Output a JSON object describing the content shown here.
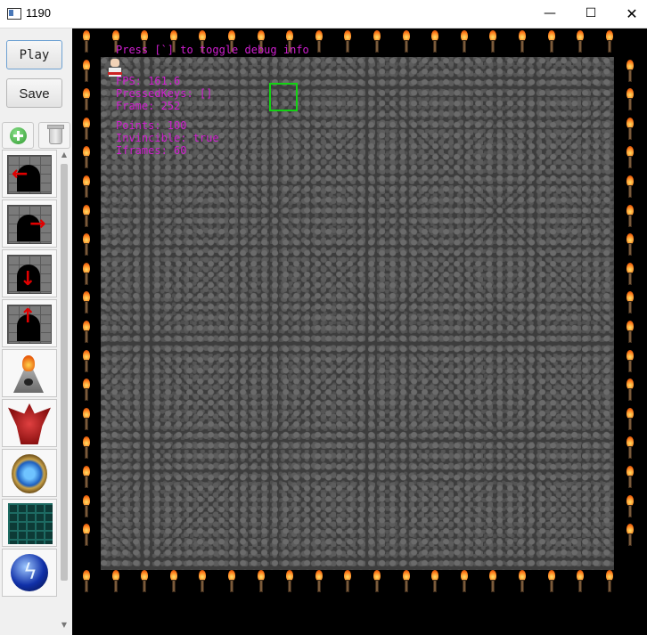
{
  "window": {
    "title": "1190",
    "minimize_glyph": "—",
    "maximize_glyph": "☐",
    "close_glyph": "✕"
  },
  "palette": {
    "play_label": "Play",
    "save_label": "Save",
    "tools": [
      {
        "name": "add-icon"
      },
      {
        "name": "trash-icon"
      }
    ],
    "items": [
      {
        "name": "door-left",
        "arrow": "←"
      },
      {
        "name": "door-right",
        "arrow": "→"
      },
      {
        "name": "door-down",
        "arrow": "↓"
      },
      {
        "name": "door-up",
        "arrow": "↑"
      },
      {
        "name": "fountain"
      },
      {
        "name": "dragon"
      },
      {
        "name": "portal"
      },
      {
        "name": "maze-tile"
      },
      {
        "name": "lightning-orb"
      }
    ],
    "scroll_up_glyph": "▲",
    "scroll_down_glyph": "▼"
  },
  "debug": {
    "hint": "Press [`] to toggle debug info",
    "fps": "FPS: 161.6",
    "pressed_keys": "PressedKeys: []",
    "frame": "Frame: 252",
    "points": "Points: 100",
    "invincible": "Invincible: true",
    "iframes": "Iframes: 60"
  },
  "colors": {
    "debug_text": "#d11ed1",
    "selector": "#12d312",
    "background": "#000000"
  }
}
